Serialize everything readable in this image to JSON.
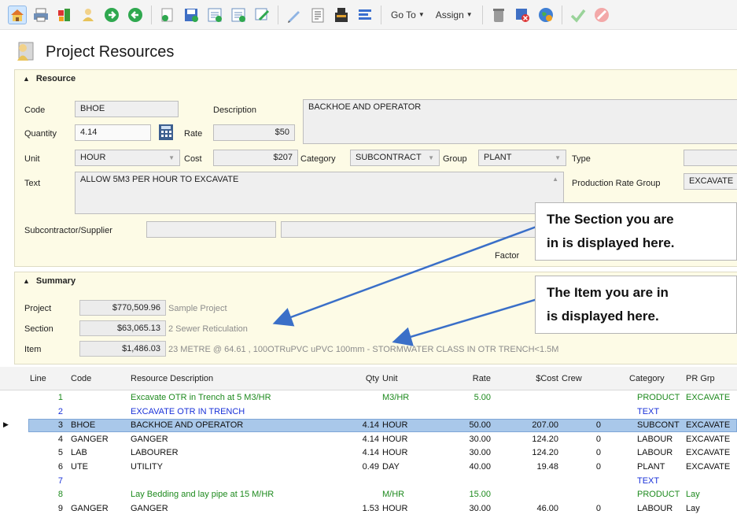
{
  "toolbar": {
    "icons": [
      "home-icon",
      "print-icon",
      "export-icon",
      "user-icon",
      "forward-icon",
      "back-icon",
      "new-icon",
      "save-icon",
      "report-icon",
      "report-add-icon",
      "edit-icon",
      "pencil-icon",
      "list-icon",
      "paste-icon",
      "align-icon",
      "bin-icon",
      "delete-icon",
      "globe-icon",
      "check-icon",
      "cancel-icon"
    ],
    "goto_label": "Go To",
    "assign_label": "Assign"
  },
  "header": {
    "title": "Project Resources"
  },
  "resource": {
    "section_title": "Resource",
    "code_label": "Code",
    "code_value": "BHOE",
    "description_label": "Description",
    "description_value": "BACKHOE AND OPERATOR",
    "quantity_label": "Quantity",
    "quantity_value": "4.14",
    "rate_label": "Rate",
    "rate_value": "$50",
    "unit_label": "Unit",
    "unit_value": "HOUR",
    "cost_label": "Cost",
    "cost_value": "$207",
    "category_label": "Category",
    "category_value": "SUBCONTRACT",
    "group_label": "Group",
    "group_value": "PLANT",
    "type_label": "Type",
    "type_value": "",
    "text_label": "Text",
    "text_value": "ALLOW 5M3 PER HOUR TO EXCAVATE",
    "prod_rate_group_label": "Production Rate Group",
    "prod_rate_group_value": "EXCAVATE",
    "subcontractor_label": "Subcontractor/Supplier",
    "factor_label": "Factor"
  },
  "summary": {
    "section_title": "Summary",
    "project_label": "Project",
    "project_value": "$770,509.96",
    "project_desc": "Sample Project",
    "section_label": "Section",
    "section_value": "$63,065.13",
    "section_desc": "2 Sewer Reticulation",
    "item_label": "Item",
    "item_value": "$1,486.03",
    "item_desc": "23 METRE @ 64.61 , 100OTRuPVC uPVC 100mm - STORMWATER CLASS IN OTR TRENCH<1.5M"
  },
  "callouts": {
    "section_line1": "The Section you are",
    "section_line2": "in is displayed here.",
    "item_line1": "The Item you are in",
    "item_line2": "is displayed here."
  },
  "grid": {
    "columns": {
      "line": "Line",
      "code": "Code",
      "desc": "Resource Description",
      "qty": "Qty",
      "unit": "Unit",
      "rate": "Rate",
      "cost": "$Cost",
      "crew": "Crew",
      "category": "Category",
      "prgrp": "PR Grp"
    },
    "rows": [
      {
        "line": "1",
        "code": "",
        "desc": "Excavate OTR in Trench at 5 M3/HR",
        "qty": "",
        "unit": "M3/HR",
        "rate": "5.00",
        "cost": "",
        "crew": "",
        "category": "PRODUCT",
        "prgrp": "EXCAVATE"
      },
      {
        "line": "2",
        "code": "",
        "desc": "EXCAVATE OTR IN TRENCH",
        "qty": "",
        "unit": "",
        "rate": "",
        "cost": "",
        "crew": "",
        "category": "TEXT",
        "prgrp": ""
      },
      {
        "line": "3",
        "code": "BHOE",
        "desc": "BACKHOE AND OPERATOR",
        "qty": "4.14",
        "unit": "HOUR",
        "rate": "50.00",
        "cost": "207.00",
        "crew": "0",
        "category": "SUBCONT",
        "prgrp": "EXCAVATE"
      },
      {
        "line": "4",
        "code": "GANGER",
        "desc": "GANGER",
        "qty": "4.14",
        "unit": "HOUR",
        "rate": "30.00",
        "cost": "124.20",
        "crew": "0",
        "category": "LABOUR",
        "prgrp": "EXCAVATE"
      },
      {
        "line": "5",
        "code": "LAB",
        "desc": "LABOURER",
        "qty": "4.14",
        "unit": "HOUR",
        "rate": "30.00",
        "cost": "124.20",
        "crew": "0",
        "category": "LABOUR",
        "prgrp": "EXCAVATE"
      },
      {
        "line": "6",
        "code": "UTE",
        "desc": "UTILITY",
        "qty": "0.49",
        "unit": "DAY",
        "rate": "40.00",
        "cost": "19.48",
        "crew": "0",
        "category": "PLANT",
        "prgrp": "EXCAVATE"
      },
      {
        "line": "7",
        "code": "",
        "desc": "",
        "qty": "",
        "unit": "",
        "rate": "",
        "cost": "",
        "crew": "",
        "category": "TEXT",
        "prgrp": ""
      },
      {
        "line": "8",
        "code": "",
        "desc": "Lay Bedding and lay pipe at 15 M/HR",
        "qty": "",
        "unit": "M/HR",
        "rate": "15.00",
        "cost": "",
        "crew": "",
        "category": "PRODUCT",
        "prgrp": "Lay"
      },
      {
        "line": "9",
        "code": "GANGER",
        "desc": "GANGER",
        "qty": "1.53",
        "unit": "HOUR",
        "rate": "30.00",
        "cost": "46.00",
        "crew": "0",
        "category": "LABOUR",
        "prgrp": "Lay"
      }
    ]
  }
}
